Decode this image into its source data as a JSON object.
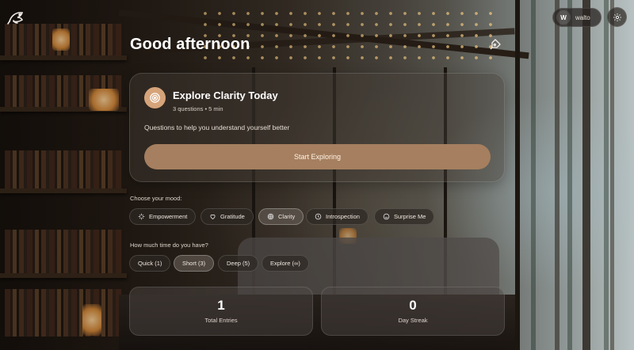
{
  "header": {
    "greeting": "Good afternoon",
    "user": {
      "initial": "W",
      "name": "walto"
    },
    "icons": {
      "logo": "bird-logo-icon",
      "settings": "gear-icon",
      "edit": "pen-nib-icon"
    }
  },
  "feature_card": {
    "title": "Explore Clarity Today",
    "meta": "3 questions • 5 min",
    "description": "Questions to help you understand yourself better",
    "button_label": "Start Exploring",
    "icon": "target-icon",
    "accent_color": "#d6a47a",
    "button_color": "#a57f5f"
  },
  "mood": {
    "label": "Choose your mood:",
    "selected": "Clarity",
    "options": [
      {
        "label": "Empowerment",
        "icon": "sparkle-icon"
      },
      {
        "label": "Gratitude",
        "icon": "heart-icon"
      },
      {
        "label": "Clarity",
        "icon": "target-icon"
      },
      {
        "label": "Introspection",
        "icon": "compass-icon"
      },
      {
        "label": "Surprise Me",
        "icon": "smile-icon"
      }
    ]
  },
  "time": {
    "label": "How much time do you have?",
    "selected": "Short (3)",
    "options": [
      {
        "label": "Quick (1)"
      },
      {
        "label": "Short (3)"
      },
      {
        "label": "Deep (5)"
      },
      {
        "label": "Explore (∞)"
      }
    ]
  },
  "stats": [
    {
      "value": "1",
      "label": "Total Entries"
    },
    {
      "value": "0",
      "label": "Day Streak"
    }
  ]
}
